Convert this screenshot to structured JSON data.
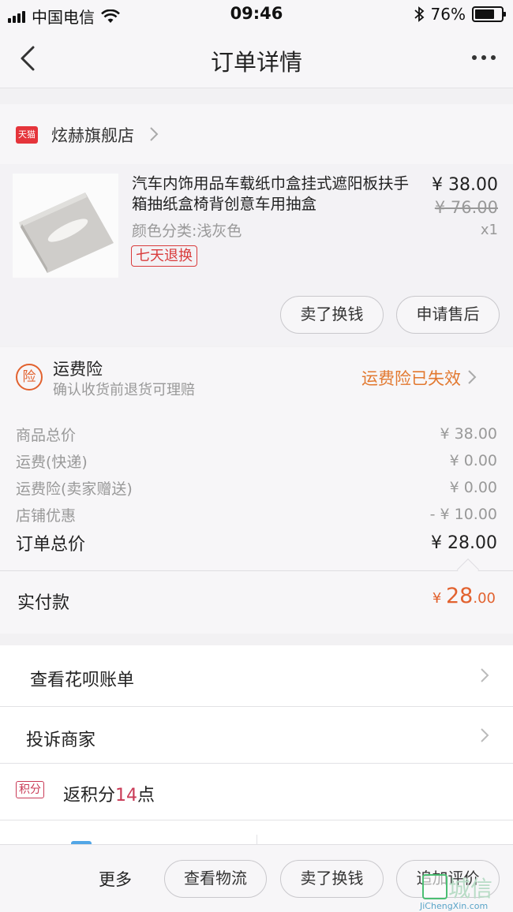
{
  "status_bar": {
    "carrier": "中国电信",
    "time": "09:46",
    "battery": "76%",
    "battery_level": 0.76
  },
  "nav": {
    "title": "订单详情"
  },
  "store": {
    "badge": "天猫",
    "name": "炫赫旗舰店"
  },
  "product": {
    "title": "汽车内饰用品车载纸巾盒挂式遮阳板扶手箱抽纸盒椅背创意车用抽盒",
    "variant": "颜色分类:浅灰色",
    "tag": "七天退换",
    "price": "¥ 38.00",
    "original_price": "¥ 76.00",
    "quantity": "x1",
    "buttons": [
      "卖了换钱",
      "申请售后"
    ]
  },
  "insurance": {
    "icon_label": "险",
    "title": "运费险",
    "subtitle": "确认收货前退货可理赔",
    "status": "运费险已失效"
  },
  "summary": {
    "rows": [
      {
        "label": "商品总价",
        "value": "¥ 38.00"
      },
      {
        "label": "运费(快递)",
        "value": "¥ 0.00"
      },
      {
        "label": "运费险(卖家赠送)",
        "value": "¥ 0.00"
      },
      {
        "label": "店铺优惠",
        "value": "- ¥ 10.00"
      }
    ],
    "total_label": "订单总价",
    "total_value": "¥ 28.00",
    "paid_label": "实付款",
    "paid_currency": "¥",
    "paid_int": "28",
    "paid_dec": ".00"
  },
  "list": {
    "huabei": "查看花呗账单",
    "complain": "投诉商家",
    "points_badge": "积分",
    "points_prefix": "返积分",
    "points_value": "14",
    "points_suffix": "点"
  },
  "bottom_bar": {
    "more": "更多",
    "buttons": [
      "查看物流",
      "卖了换钱",
      "追加评价"
    ]
  },
  "watermark": {
    "text": "城信",
    "url": "JiChengXin.com"
  },
  "colors": {
    "accent_orange": "#e2622f",
    "tag_red": "#d93c3c",
    "tmall_red": "#e5343b",
    "points_red": "#c93a56"
  }
}
